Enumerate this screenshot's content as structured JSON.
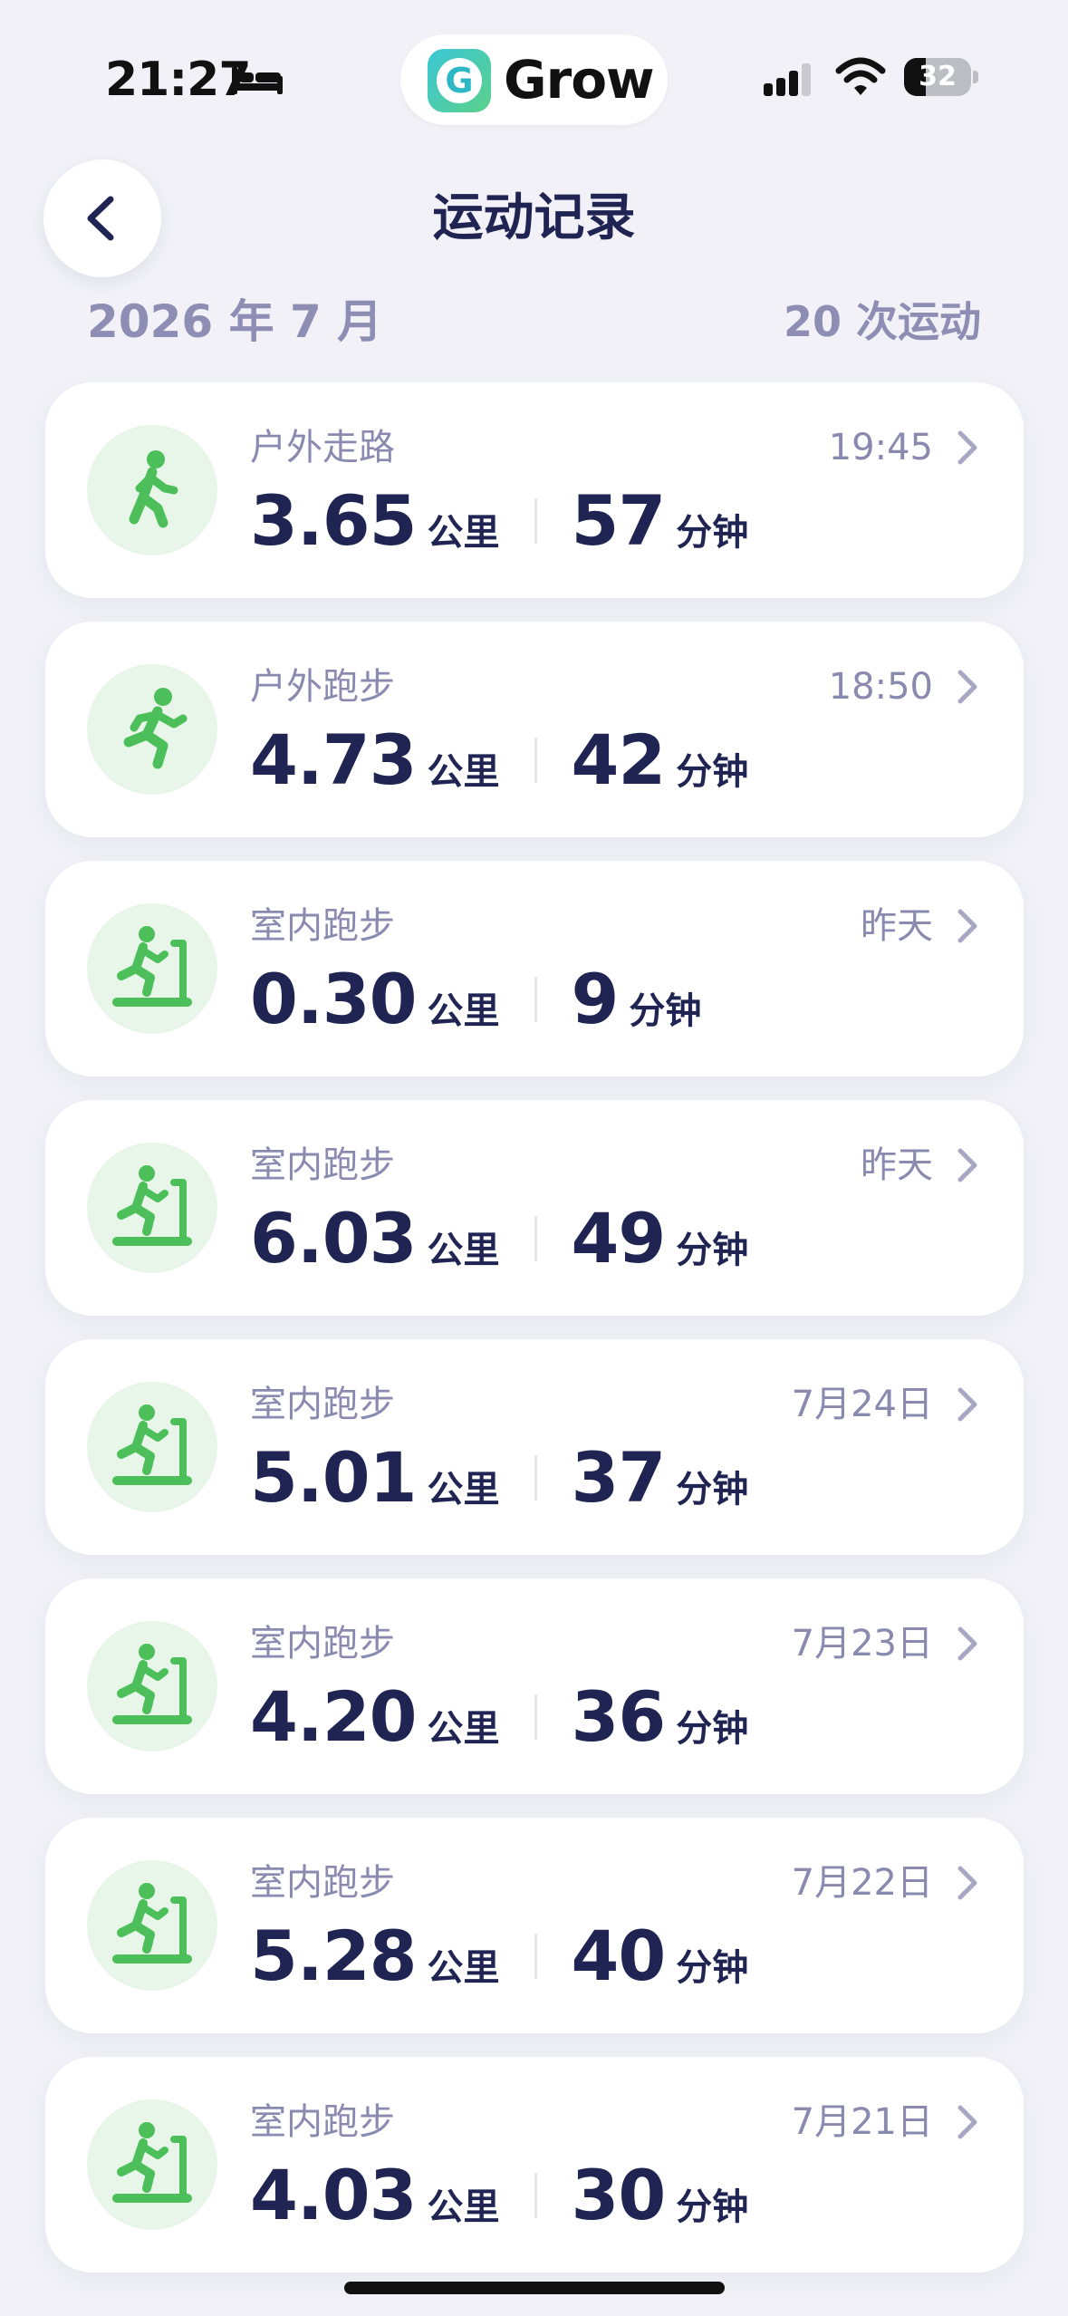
{
  "status_bar": {
    "time": "21:27",
    "app_name": "Grow",
    "app_logo_letter": "G",
    "battery_level": "32",
    "battery_percent": 32,
    "icons": [
      "bed-icon",
      "signal-icon",
      "wifi-icon",
      "battery-icon"
    ]
  },
  "nav": {
    "title": "运动记录",
    "back_icon": "chevron-left-icon"
  },
  "summary": {
    "month": "2026 年 7 月",
    "count": "20 次运动"
  },
  "colors": {
    "background": "#F1F1F7",
    "card": "#FFFFFF",
    "primary_text": "#1F2452",
    "secondary_text": "#8A89B0",
    "accent_green": "#4CBF5A",
    "icon_background": "#E8F6EA"
  },
  "workouts": [
    {
      "type": "户外走路",
      "icon": "walking-icon",
      "date": "19:45",
      "distance": "3.65",
      "distance_unit": "公里",
      "duration": "57",
      "duration_unit": "分钟"
    },
    {
      "type": "户外跑步",
      "icon": "running-icon",
      "date": "18:50",
      "distance": "4.73",
      "distance_unit": "公里",
      "duration": "42",
      "duration_unit": "分钟"
    },
    {
      "type": "室内跑步",
      "icon": "treadmill-icon",
      "date": "昨天",
      "distance": "0.30",
      "distance_unit": "公里",
      "duration": "9",
      "duration_unit": "分钟"
    },
    {
      "type": "室内跑步",
      "icon": "treadmill-icon",
      "date": "昨天",
      "distance": "6.03",
      "distance_unit": "公里",
      "duration": "49",
      "duration_unit": "分钟"
    },
    {
      "type": "室内跑步",
      "icon": "treadmill-icon",
      "date": "7月24日",
      "distance": "5.01",
      "distance_unit": "公里",
      "duration": "37",
      "duration_unit": "分钟"
    },
    {
      "type": "室内跑步",
      "icon": "treadmill-icon",
      "date": "7月23日",
      "distance": "4.20",
      "distance_unit": "公里",
      "duration": "36",
      "duration_unit": "分钟"
    },
    {
      "type": "室内跑步",
      "icon": "treadmill-icon",
      "date": "7月22日",
      "distance": "5.28",
      "distance_unit": "公里",
      "duration": "40",
      "duration_unit": "分钟"
    },
    {
      "type": "室内跑步",
      "icon": "treadmill-icon",
      "date": "7月21日",
      "distance": "4.03",
      "distance_unit": "公里",
      "duration": "30",
      "duration_unit": "分钟"
    }
  ]
}
